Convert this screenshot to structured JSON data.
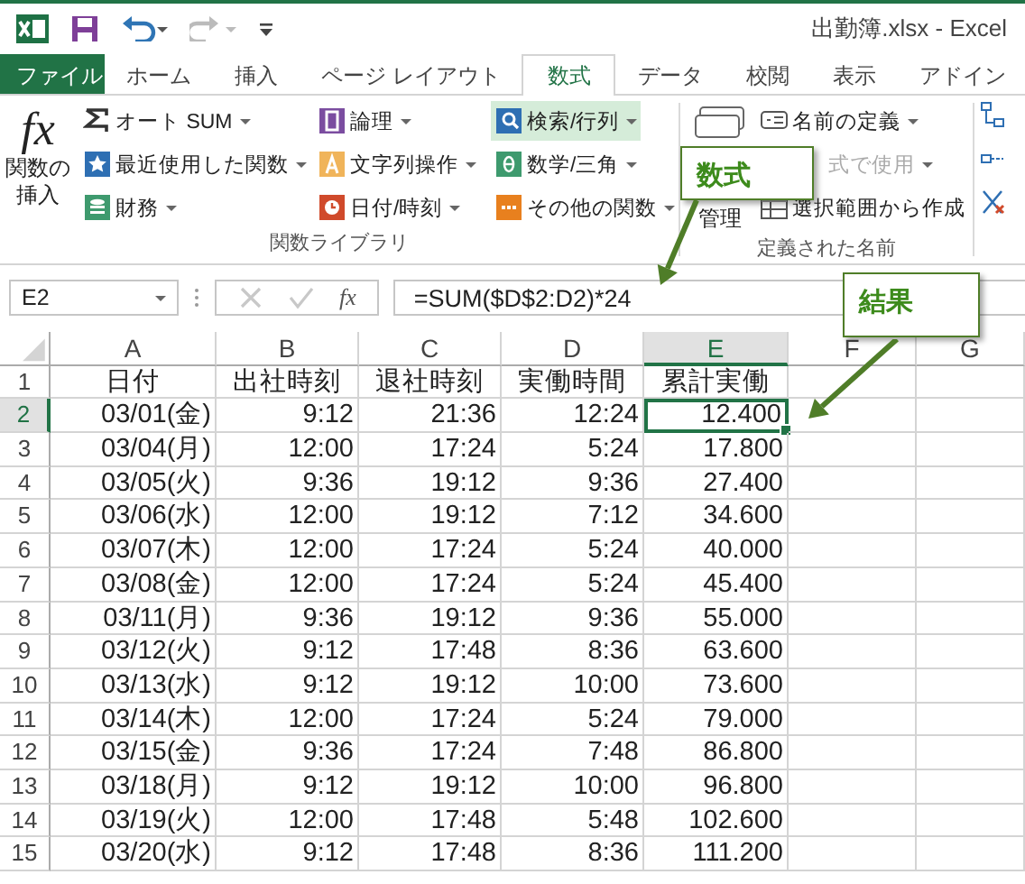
{
  "window": {
    "title": "出勤簿.xlsx - Excel"
  },
  "tabs": [
    {
      "label": "ファイル",
      "kind": "file",
      "selected": false
    },
    {
      "label": "ホーム",
      "kind": "tab",
      "selected": false
    },
    {
      "label": "挿入",
      "kind": "tab",
      "selected": false
    },
    {
      "label": "ページ レイアウト",
      "kind": "tab",
      "selected": false
    },
    {
      "label": "数式",
      "kind": "tab",
      "selected": true
    },
    {
      "label": "データ",
      "kind": "tab",
      "selected": false
    },
    {
      "label": "校閲",
      "kind": "tab",
      "selected": false
    },
    {
      "label": "表示",
      "kind": "tab",
      "selected": false
    },
    {
      "label": "アドイン",
      "kind": "tab",
      "selected": false
    }
  ],
  "ribbon": {
    "insert_function": {
      "glyph": "fx",
      "label": "関数の挿入"
    },
    "function_library": {
      "label": "関数ライブラリ",
      "columns": [
        [
          {
            "label": "オート SUM",
            "selected": false
          },
          {
            "label": "最近使用した関数",
            "selected": false
          },
          {
            "label": "財務",
            "selected": false
          }
        ],
        [
          {
            "label": "論理",
            "selected": false
          },
          {
            "label": "文字列操作",
            "selected": false
          },
          {
            "label": "日付/時刻",
            "selected": false
          }
        ],
        [
          {
            "label": "検索/行列",
            "selected": true
          },
          {
            "label": "数学/三角",
            "selected": false
          },
          {
            "label": "その他の関数",
            "selected": false
          }
        ]
      ]
    },
    "defined_names": {
      "label": "定義された名前",
      "manager": "管理",
      "items": [
        {
          "label": "名前の定義",
          "disabled": false
        },
        {
          "label": "式で使用",
          "disabled": true
        },
        {
          "label": "選択範囲から作成",
          "disabled": false
        }
      ]
    }
  },
  "formula_bar": {
    "name_box": "E2",
    "fx": "fx",
    "formula": "=SUM($D$2:D2)*24"
  },
  "sheet": {
    "columns": [
      {
        "label": "A",
        "selected": false
      },
      {
        "label": "B",
        "selected": false
      },
      {
        "label": "C",
        "selected": false
      },
      {
        "label": "D",
        "selected": false
      },
      {
        "label": "E",
        "selected": true
      },
      {
        "label": "F",
        "selected": false
      },
      {
        "label": "G",
        "selected": false
      }
    ],
    "rows": [
      {
        "number": "1",
        "selected": false,
        "kind": "header",
        "cells": [
          "日付",
          "出社時刻",
          "退社時刻",
          "実働時間",
          "累計実働"
        ]
      },
      {
        "number": "2",
        "selected": true,
        "kind": "data",
        "cells": [
          "03/01(金)",
          "9:12",
          "21:36",
          "12:24",
          "12.400"
        ]
      },
      {
        "number": "3",
        "selected": false,
        "kind": "data",
        "cells": [
          "03/04(月)",
          "12:00",
          "17:24",
          "5:24",
          "17.800"
        ]
      },
      {
        "number": "4",
        "selected": false,
        "kind": "data",
        "cells": [
          "03/05(火)",
          "9:36",
          "19:12",
          "9:36",
          "27.400"
        ]
      },
      {
        "number": "5",
        "selected": false,
        "kind": "data",
        "cells": [
          "03/06(水)",
          "12:00",
          "19:12",
          "7:12",
          "34.600"
        ]
      },
      {
        "number": "6",
        "selected": false,
        "kind": "data",
        "cells": [
          "03/07(木)",
          "12:00",
          "17:24",
          "5:24",
          "40.000"
        ]
      },
      {
        "number": "7",
        "selected": false,
        "kind": "data",
        "cells": [
          "03/08(金)",
          "12:00",
          "17:24",
          "5:24",
          "45.400"
        ]
      },
      {
        "number": "8",
        "selected": false,
        "kind": "data",
        "cells": [
          "03/11(月)",
          "9:36",
          "19:12",
          "9:36",
          "55.000"
        ]
      },
      {
        "number": "9",
        "selected": false,
        "kind": "data",
        "cells": [
          "03/12(火)",
          "9:12",
          "17:48",
          "8:36",
          "63.600"
        ]
      },
      {
        "number": "10",
        "selected": false,
        "kind": "data",
        "cells": [
          "03/13(水)",
          "9:12",
          "19:12",
          "10:00",
          "73.600"
        ]
      },
      {
        "number": "11",
        "selected": false,
        "kind": "data",
        "cells": [
          "03/14(木)",
          "12:00",
          "17:24",
          "5:24",
          "79.000"
        ]
      },
      {
        "number": "12",
        "selected": false,
        "kind": "data",
        "cells": [
          "03/15(金)",
          "9:36",
          "17:24",
          "7:48",
          "86.800"
        ]
      },
      {
        "number": "13",
        "selected": false,
        "kind": "data",
        "cells": [
          "03/18(月)",
          "9:12",
          "19:12",
          "10:00",
          "96.800"
        ]
      },
      {
        "number": "14",
        "selected": false,
        "kind": "data",
        "cells": [
          "03/19(火)",
          "12:00",
          "17:48",
          "5:48",
          "102.600"
        ]
      },
      {
        "number": "15",
        "selected": false,
        "kind": "data",
        "cells": [
          "03/20(水)",
          "9:12",
          "17:48",
          "8:36",
          "111.200"
        ]
      }
    ]
  },
  "callouts": [
    {
      "text": "数式"
    },
    {
      "text": "結果"
    }
  ]
}
